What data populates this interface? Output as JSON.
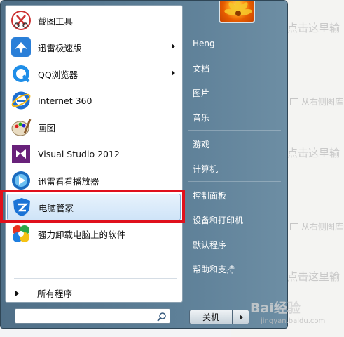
{
  "programs": [
    {
      "label": "截图工具",
      "icon": "scissors-icon",
      "arrow": false
    },
    {
      "label": "迅雷极速版",
      "icon": "thunder-bird-icon",
      "arrow": true
    },
    {
      "label": "QQ浏览器",
      "icon": "qq-browser-icon",
      "arrow": true
    },
    {
      "label": "Internet 360",
      "icon": "internet-explorer-icon",
      "arrow": false
    },
    {
      "label": "画图",
      "icon": "paint-palette-icon",
      "arrow": false
    },
    {
      "label": "Visual Studio 2012",
      "icon": "visual-studio-icon",
      "arrow": false
    },
    {
      "label": "迅雷看看播放器",
      "icon": "xunlei-player-icon",
      "arrow": false
    },
    {
      "label": "电脑管家",
      "icon": "pc-manager-shield-icon",
      "arrow": false,
      "highlighted": true
    },
    {
      "label": "强力卸载电脑上的软件",
      "icon": "uninstall-pinwheel-icon",
      "arrow": false
    }
  ],
  "all_programs_label": "所有程序",
  "search": {
    "placeholder": ""
  },
  "right_items": [
    "Heng",
    "文档",
    "图片",
    "音乐",
    "游戏",
    "计算机",
    "控制面板",
    "设备和打印机",
    "默认程序",
    "帮助和支持"
  ],
  "shutdown_label": "关机",
  "background": {
    "click_text": "点击这里输",
    "image_text": "从右侧图库"
  },
  "watermark": {
    "brand": "Bai经验",
    "url": "jingyan.baidu.com"
  },
  "colors": {
    "highlight_border": "#e0101c",
    "menu_blue": "#5d7f97"
  }
}
